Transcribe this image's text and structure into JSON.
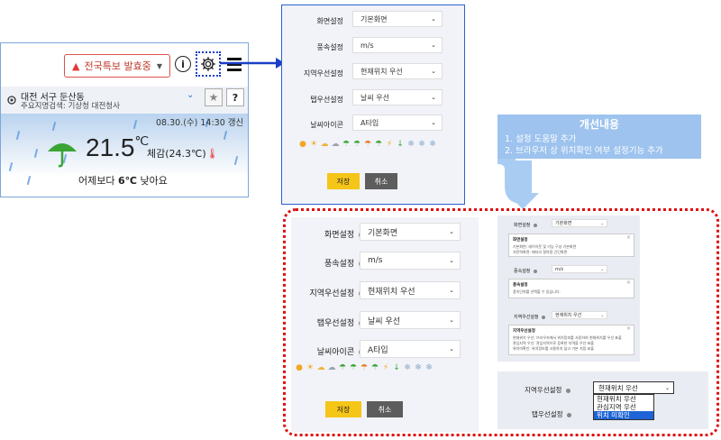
{
  "weather_widget": {
    "alert_label": "전국특보 발효중",
    "location_name": "대전 서구 둔산동",
    "location_sub": "주요지명검색: 기상청 대전청사",
    "time_text": "08.30.(수) 14:30 갱신",
    "temperature": "21.5",
    "temp_unit": "℃",
    "feels_like": "체감(24.3℃)",
    "yday_prefix": "어제보다 ",
    "yday_value": "6℃",
    "yday_suffix": " 낮아요"
  },
  "settings_top": {
    "rows": [
      {
        "label": "화면설정",
        "value": "기본화면"
      },
      {
        "label": "풍속설정",
        "value": "m/s"
      },
      {
        "label": "지역우선설정",
        "value": "현재위치 우선"
      },
      {
        "label": "탭우선설정",
        "value": "날씨 우선"
      },
      {
        "label": "날씨아이콘",
        "value": "A타입"
      }
    ],
    "save_label": "저장",
    "cancel_label": "취소"
  },
  "improvement": {
    "title": "개선내용",
    "items": [
      "1. 설정 도움말 추가",
      "2. 브라우저 상 위치확인 여부 설정기능 추가"
    ]
  },
  "settings_bottom": {
    "rows": [
      {
        "label": "화면설정",
        "value": "기본화면"
      },
      {
        "label": "풍속설정",
        "value": "m/s"
      },
      {
        "label": "지역우선설정",
        "value": "현재위치 우선"
      },
      {
        "label": "탭우선설정",
        "value": "날씨 우선"
      },
      {
        "label": "날씨아이콘",
        "value": "A타입"
      }
    ],
    "save_label": "저장",
    "cancel_label": "취소"
  },
  "help_panel": {
    "rows": [
      {
        "label": "화면설정",
        "value": "기본화면",
        "tip_title": "화면설정",
        "tip_lines": [
          "기본화면: 레이아웃 및 기능 구성 기본화면",
          "저전력화면: 배터리 절약용 간단화면"
        ]
      },
      {
        "label": "풍속설정",
        "value": "m/s",
        "tip_title": "풍속설정",
        "tip_lines": [
          "풍속단위를 선택할 수 있습니다."
        ]
      },
      {
        "label": "지역우선설정",
        "value": "현재위치 우선",
        "tip_title": "지역우선설정",
        "tip_lines": [
          "현재위치 우선: 브라우저에서 위치정보를 사용하여 현재위치를 우선 표출",
          "관심지역 우선: 관심지역으로 등록한 지역을 우선 표출",
          "위치미확인: 위치정보를 사용하지 않고 기본 지점 표출"
        ]
      }
    ]
  },
  "dropdown_panel": {
    "region_label": "지역우선설정",
    "region_value": "현재위치 우선",
    "tab_label": "탭우선설정",
    "options": [
      "현재위치 우선",
      "관심지역 우선",
      "위치 미확인"
    ],
    "selected_index": 2
  },
  "colors": {
    "accent_blue": "#2f5fcf",
    "save_yellow": "#f5c518",
    "alert_red": "#d9534f",
    "frame_red": "#dd1111",
    "callout_blue": "#9dc3ee"
  }
}
